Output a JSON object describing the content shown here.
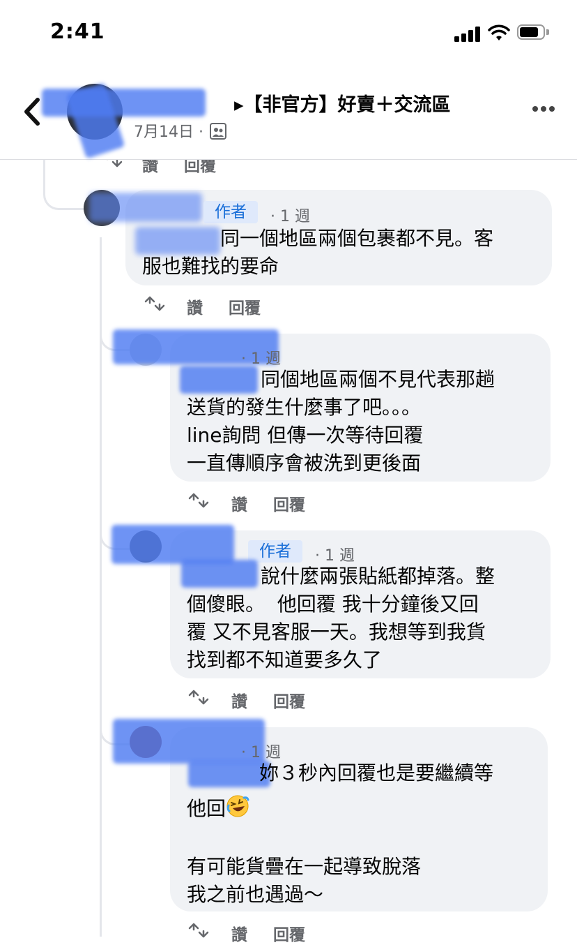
{
  "status_bar": {
    "time": "2:41"
  },
  "header": {
    "title": "▸【非官方】好賣＋交流區",
    "date": "7月14日 ·"
  },
  "top_actions": {
    "like": "讚",
    "reply": "回覆"
  },
  "comments": [
    {
      "author_tag": "作者",
      "time": "· 1 週",
      "lines": [
        "同一個地區兩個包裹都不見。客",
        "服也難找的要命"
      ],
      "like": "讚",
      "reply": "回覆"
    },
    {
      "time": "· 1 週",
      "lines": [
        "同個地區兩個不見代表那趟",
        "送貨的發生什麼事了吧。。。",
        "line詢問 但傳一次等待回覆",
        "一直傳順序會被洗到更後面"
      ],
      "like": "讚",
      "reply": "回覆"
    },
    {
      "author_tag": "作者",
      "time": "· 1 週",
      "lines": [
        "說什麼兩張貼紙都掉落。整",
        "個傻眼。  他回覆 我十分鐘後又回",
        "覆 又不見客服一天。我想等到我貨",
        "找到都不知道要多久了"
      ],
      "like": "讚",
      "reply": "回覆"
    },
    {
      "time": "· 1 週",
      "lines": [
        "妳３秒內回覆也是要繼續等",
        "他回",
        "",
        "有可能貨疊在一起導致脫落",
        "我之前也遇過～"
      ],
      "like": "讚",
      "reply": "回覆"
    }
  ],
  "icons": {
    "back": "chevron-left-icon",
    "more": "more-horizontal-icon",
    "audience": "group-icon",
    "share": "share-icon",
    "emoji": "rolling-laughing-emoji"
  },
  "colors": {
    "author_tag_bg": "#dfe9fb",
    "author_tag_text": "#1b6fd8",
    "bubble": "#f0f2f5",
    "meta": "#65676b"
  }
}
